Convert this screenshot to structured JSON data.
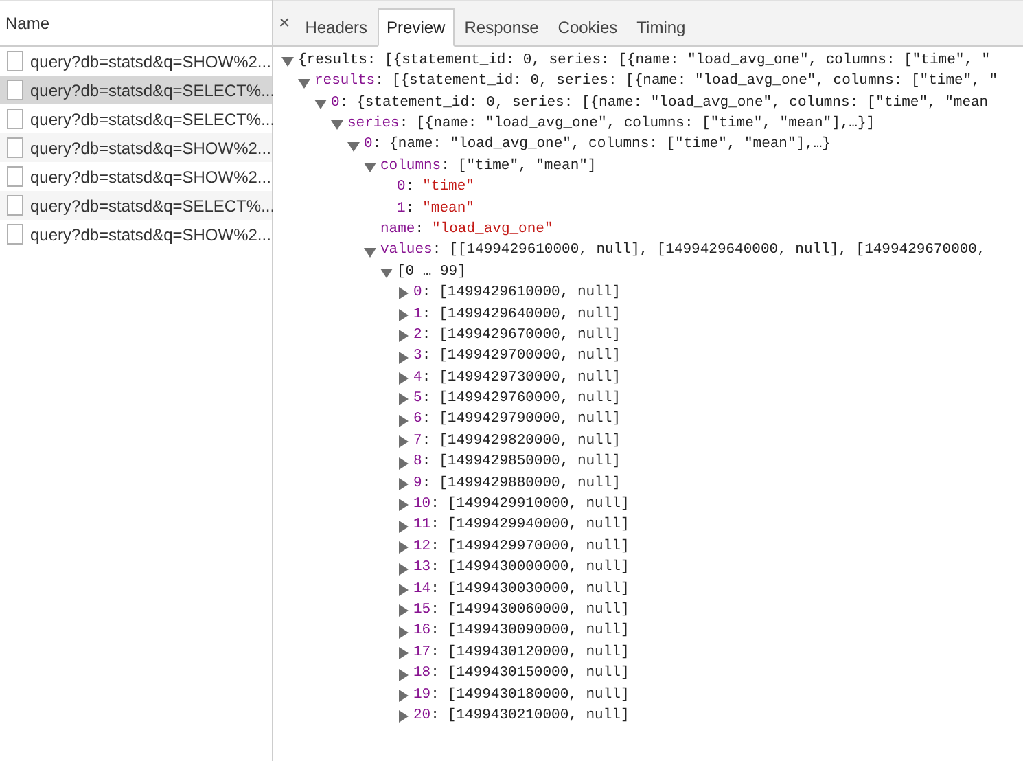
{
  "requests": {
    "header": "Name",
    "rows": [
      {
        "name": "query?db=statsd&q=SHOW%2...",
        "selected": false
      },
      {
        "name": "query?db=statsd&q=SELECT%...",
        "selected": true
      },
      {
        "name": "query?db=statsd&q=SELECT%...",
        "selected": false
      },
      {
        "name": "query?db=statsd&q=SHOW%2...",
        "selected": false
      },
      {
        "name": "query?db=statsd&q=SHOW%2...",
        "selected": false
      },
      {
        "name": "query?db=statsd&q=SELECT%...",
        "selected": false
      },
      {
        "name": "query?db=statsd&q=SHOW%2...",
        "selected": false
      }
    ]
  },
  "close_label": "×",
  "tabs": [
    {
      "label": "Headers",
      "selected": false
    },
    {
      "label": "Preview",
      "selected": true
    },
    {
      "label": "Response",
      "selected": false
    },
    {
      "label": "Cookies",
      "selected": false
    },
    {
      "label": "Timing",
      "selected": false
    }
  ],
  "preview": {
    "value": "{results: [{statement_id: 0, series: [{name: \"load_avg_one\", columns: [\"time\", \"",
    "expanded": true,
    "children": [
      {
        "key": "results:",
        "value": "[{statement_id: 0, series: [{name: \"load_avg_one\", columns: [\"time\", \"",
        "expanded": true,
        "children": [
          {
            "key": "0:",
            "value": "{statement_id: 0, series: [{name: \"load_avg_one\", columns: [\"time\", \"mean",
            "expanded": true,
            "children": [
              {
                "key": "series:",
                "value": "[{name: \"load_avg_one\", columns: [\"time\", \"mean\"],…}]",
                "expanded": true,
                "children": [
                  {
                    "key": "0:",
                    "value": "{name: \"load_avg_one\", columns: [\"time\", \"mean\"],…}",
                    "expanded": true,
                    "children": [
                      {
                        "key": "columns:",
                        "value": "[\"time\", \"mean\"]",
                        "expanded": true,
                        "children": [
                          {
                            "key": "0:",
                            "value": "\"time\"",
                            "kind": "string"
                          },
                          {
                            "key": "1:",
                            "value": "\"mean\"",
                            "kind": "string"
                          }
                        ]
                      },
                      {
                        "key": "name:",
                        "value": "\"load_avg_one\"",
                        "kind": "string"
                      },
                      {
                        "key": "values:",
                        "value": "[[1499429610000, null], [1499429640000, null], [1499429670000,",
                        "expanded": true,
                        "children": [
                          {
                            "value": "[0 … 99]",
                            "expanded": true,
                            "children": [
                              {
                                "key": "0:",
                                "value": "[1499429610000, null]",
                                "expanded": false
                              },
                              {
                                "key": "1:",
                                "value": "[1499429640000, null]",
                                "expanded": false
                              },
                              {
                                "key": "2:",
                                "value": "[1499429670000, null]",
                                "expanded": false
                              },
                              {
                                "key": "3:",
                                "value": "[1499429700000, null]",
                                "expanded": false
                              },
                              {
                                "key": "4:",
                                "value": "[1499429730000, null]",
                                "expanded": false
                              },
                              {
                                "key": "5:",
                                "value": "[1499429760000, null]",
                                "expanded": false
                              },
                              {
                                "key": "6:",
                                "value": "[1499429790000, null]",
                                "expanded": false
                              },
                              {
                                "key": "7:",
                                "value": "[1499429820000, null]",
                                "expanded": false
                              },
                              {
                                "key": "8:",
                                "value": "[1499429850000, null]",
                                "expanded": false
                              },
                              {
                                "key": "9:",
                                "value": "[1499429880000, null]",
                                "expanded": false
                              },
                              {
                                "key": "10:",
                                "value": "[1499429910000, null]",
                                "expanded": false
                              },
                              {
                                "key": "11:",
                                "value": "[1499429940000, null]",
                                "expanded": false
                              },
                              {
                                "key": "12:",
                                "value": "[1499429970000, null]",
                                "expanded": false
                              },
                              {
                                "key": "13:",
                                "value": "[1499430000000, null]",
                                "expanded": false
                              },
                              {
                                "key": "14:",
                                "value": "[1499430030000, null]",
                                "expanded": false
                              },
                              {
                                "key": "15:",
                                "value": "[1499430060000, null]",
                                "expanded": false
                              },
                              {
                                "key": "16:",
                                "value": "[1499430090000, null]",
                                "expanded": false
                              },
                              {
                                "key": "17:",
                                "value": "[1499430120000, null]",
                                "expanded": false
                              },
                              {
                                "key": "18:",
                                "value": "[1499430150000, null]",
                                "expanded": false
                              },
                              {
                                "key": "19:",
                                "value": "[1499430180000, null]",
                                "expanded": false
                              },
                              {
                                "key": "20:",
                                "value": "[1499430210000, null]",
                                "expanded": false
                              }
                            ]
                          }
                        ]
                      }
                    ]
                  }
                ]
              }
            ]
          }
        ]
      }
    ]
  }
}
